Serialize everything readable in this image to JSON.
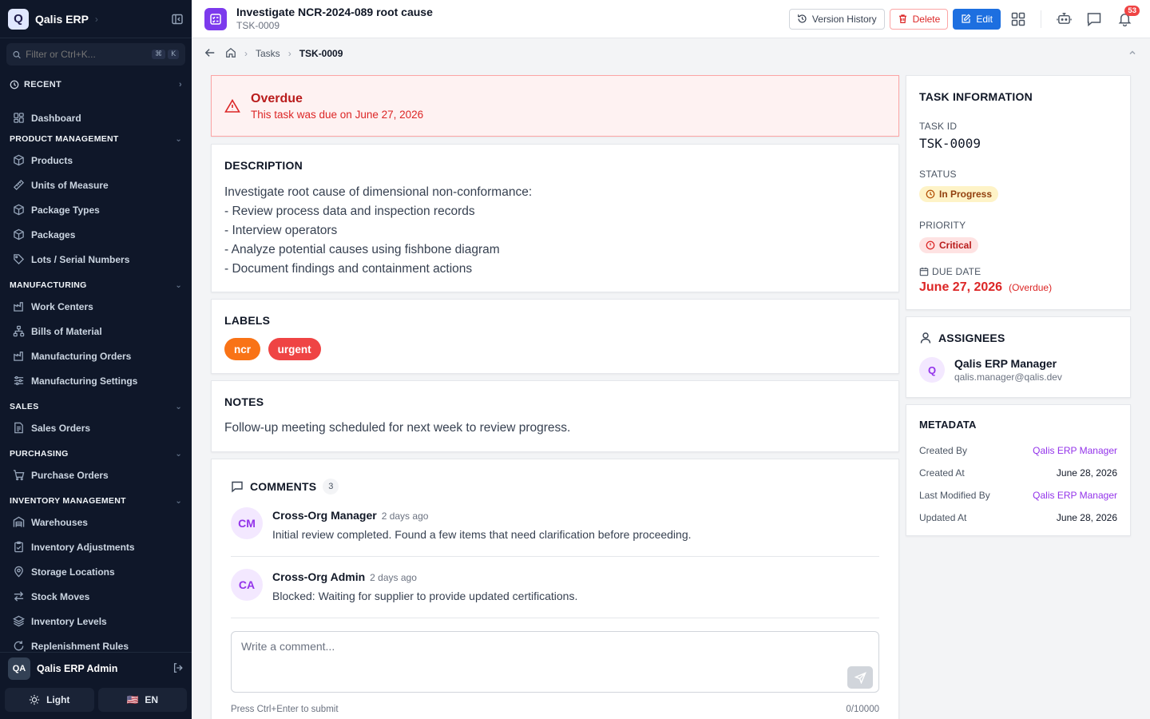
{
  "brand": {
    "logo_letter": "Q",
    "name": "Qalis ERP"
  },
  "sidebar": {
    "filter_placeholder": "Filter or Ctrl+K...",
    "shortcut_keys": [
      "⌘",
      "K"
    ],
    "recent_label": "RECENT",
    "dashboard": "Dashboard",
    "sections": [
      {
        "title": "PRODUCT MANAGEMENT",
        "items": [
          "Products",
          "Units of Measure",
          "Package Types",
          "Packages",
          "Lots / Serial Numbers"
        ]
      },
      {
        "title": "MANUFACTURING",
        "items": [
          "Work Centers",
          "Bills of Material",
          "Manufacturing Orders",
          "Manufacturing Settings"
        ]
      },
      {
        "title": "SALES",
        "items": [
          "Sales Orders"
        ]
      },
      {
        "title": "PURCHASING",
        "items": [
          "Purchase Orders"
        ]
      },
      {
        "title": "INVENTORY MANAGEMENT",
        "items": [
          "Warehouses",
          "Inventory Adjustments",
          "Storage Locations",
          "Stock Moves",
          "Inventory Levels",
          "Replenishment Rules"
        ]
      }
    ],
    "user": {
      "initials": "QA",
      "name": "Qalis ERP Admin"
    },
    "theme_label": "Light",
    "lang_flag": "🇺🇸",
    "lang_label": "EN"
  },
  "header": {
    "title": "Investigate NCR-2024-089 root cause",
    "subtitle": "TSK-0009",
    "version_history": "Version History",
    "delete": "Delete",
    "edit": "Edit",
    "notification_count": "53"
  },
  "breadcrumb": {
    "parent": "Tasks",
    "current": "TSK-0009"
  },
  "alert": {
    "title": "Overdue",
    "text": "This task was due on June 27, 2026"
  },
  "description": {
    "title": "DESCRIPTION",
    "lines": [
      "Investigate root cause of dimensional non-conformance:",
      "- Review process data and inspection records",
      "- Interview operators",
      "- Analyze potential causes using fishbone diagram",
      "- Document findings and containment actions"
    ]
  },
  "labels": {
    "title": "LABELS",
    "items": [
      "ncr",
      "urgent"
    ]
  },
  "notes": {
    "title": "NOTES",
    "text": "Follow-up meeting scheduled for next week to review progress."
  },
  "comments": {
    "title": "COMMENTS",
    "count": "3",
    "items": [
      {
        "initials": "CM",
        "author": "Cross-Org Manager",
        "time": "2 days ago",
        "text": "Initial review completed. Found a few items that need clarification before proceeding."
      },
      {
        "initials": "CA",
        "author": "Cross-Org Admin",
        "time": "2 days ago",
        "text": "Blocked: Waiting for supplier to provide updated certifications."
      }
    ],
    "placeholder": "Write a comment...",
    "hint": "Press Ctrl+Enter to submit",
    "char_count": "0/10000"
  },
  "task_info": {
    "title": "TASK INFORMATION",
    "id_label": "TASK ID",
    "id_value": "TSK-0009",
    "status_label": "STATUS",
    "status_value": "In Progress",
    "priority_label": "PRIORITY",
    "priority_value": "Critical",
    "due_label": "DUE DATE",
    "due_value": "June 27, 2026",
    "due_note": "(Overdue)"
  },
  "assignees": {
    "title": "ASSIGNEES",
    "items": [
      {
        "initial": "Q",
        "name": "Qalis ERP Manager",
        "email": "qalis.manager@qalis.dev"
      }
    ]
  },
  "metadata": {
    "title": "METADATA",
    "rows": [
      {
        "key": "Created By",
        "value": "Qalis ERP Manager"
      },
      {
        "key": "Created At",
        "value": "June 28, 2026"
      },
      {
        "key": "Last Modified By",
        "value": "Qalis ERP Manager"
      },
      {
        "key": "Updated At",
        "value": "June 28, 2026"
      }
    ]
  },
  "colors": {
    "sidebar_bg": "#0f1729",
    "accent": "#1d6fe0",
    "danger": "#dc2626",
    "label_ncr": "#f97316",
    "label_urgent": "#ef4444",
    "purple": "#9333ea"
  }
}
